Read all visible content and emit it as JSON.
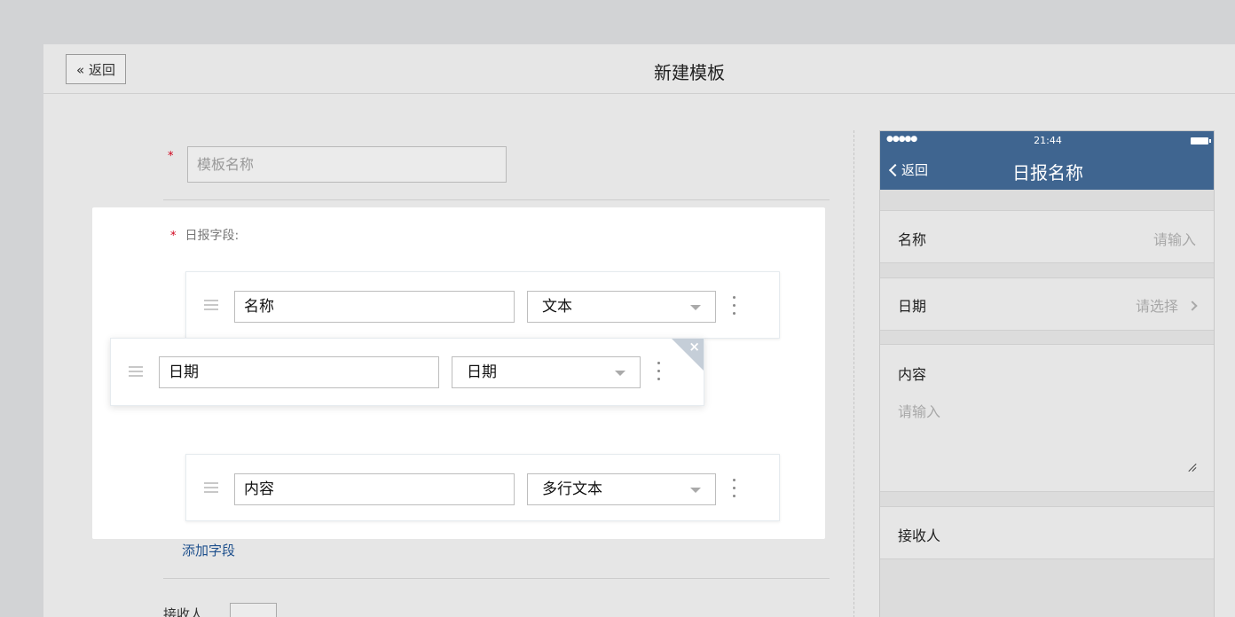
{
  "header": {
    "back_label": "« 返回",
    "title": "新建模板"
  },
  "form": {
    "required_mark": "*",
    "template_name_placeholder": "模板名称",
    "fields_label": "日报字段:",
    "fields": [
      {
        "name": "名称",
        "type": "文本"
      },
      {
        "name": "日期",
        "type": "日期",
        "dragging": true
      },
      {
        "name": "内容",
        "type": "多行文本"
      }
    ],
    "close_symbol": "×",
    "add_field_label": "添加字段",
    "receiver_label": "接收人"
  },
  "preview": {
    "status_dots": "●●●●●",
    "status_time": "21:44",
    "back_label": "返回",
    "title": "日报名称",
    "rows": {
      "name_label": "名称",
      "name_value": "请输入",
      "date_label": "日期",
      "date_value": "请选择",
      "content_label": "内容",
      "content_value": "请输入",
      "receiver_label": "接收人"
    }
  },
  "colors": {
    "accent_blue": "#3f6590",
    "link_blue": "#1d4f8c",
    "required_red": "#d0021b"
  }
}
